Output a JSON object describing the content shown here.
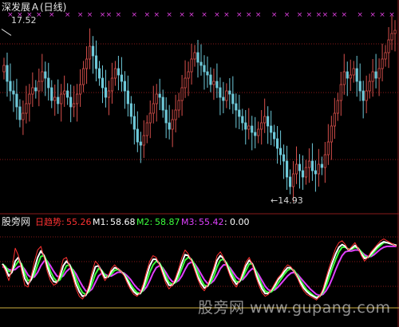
{
  "upper": {
    "title": "深发展Ａ(日线)",
    "high_label": "17.52",
    "low_label": "←14.93",
    "high_value": 17.52,
    "low_value": 14.93,
    "price_range": [
      14.7,
      17.75
    ],
    "marker_glyph": "×"
  },
  "lower": {
    "brand": "股旁网",
    "indicator_label": "日趋势:",
    "indicator_value": "55.26",
    "m1_label": "M1:",
    "m1_value": "58.68",
    "m2_label": "M2:",
    "m2_value": "58.87",
    "m3_label": "M3:",
    "m3_value": "55.42",
    "sep": ":",
    "extra_value": "0.00"
  },
  "watermark": "股旁网 www.gupang.com",
  "colors": {
    "up": "#d8504c",
    "down": "#6ec9d9",
    "grid": "#8a1a1a",
    "marker": "#e040e0",
    "title": "#e8e8e8",
    "indicator": "#ff3232",
    "m1": "#ffffff",
    "m2": "#3cff3c",
    "m3": "#e040ff",
    "extra": "#ffffff",
    "zero_line": "#d0b040"
  },
  "chart_data": [
    {
      "type": "candlestick",
      "title": "深发展Ａ(日线)",
      "annotations": [
        {
          "text": "17.52",
          "value": 17.52
        },
        {
          "text": "←14.93",
          "value": 14.93
        }
      ],
      "closes": [
        16.95,
        16.7,
        16.55,
        16.5,
        16.3,
        16.1,
        16.2,
        16.35,
        16.5,
        16.6,
        16.55,
        16.7,
        16.85,
        16.75,
        16.6,
        16.4,
        16.45,
        16.35,
        16.5,
        16.55,
        16.45,
        16.3,
        16.35,
        16.5,
        16.65,
        16.9,
        17.05,
        17.25,
        17.1,
        16.9,
        16.75,
        16.6,
        16.45,
        16.55,
        16.75,
        16.9,
        16.8,
        16.7,
        16.55,
        16.35,
        16.15,
        15.95,
        15.75,
        15.7,
        15.85,
        16.05,
        16.2,
        16.35,
        16.5,
        16.45,
        16.25,
        16.05,
        15.95,
        16.1,
        16.25,
        16.4,
        16.6,
        16.75,
        16.85,
        17.05,
        17.15,
        17.0,
        16.95,
        16.85,
        16.8,
        16.65,
        16.7,
        16.6,
        16.45,
        16.4,
        16.55,
        16.5,
        16.35,
        16.25,
        16.15,
        16.05,
        15.95,
        16.0,
        15.9,
        15.85,
        15.95,
        16.05,
        16.15,
        16.0,
        15.9,
        15.8,
        15.65,
        15.55,
        15.45,
        15.2,
        15.05,
        15.25,
        15.4,
        15.3,
        15.2,
        15.35,
        15.45,
        15.3,
        15.25,
        15.4,
        15.35,
        15.55,
        15.75,
        16.0,
        16.2,
        16.4,
        16.65,
        16.85,
        16.75,
        16.8,
        16.9,
        16.7,
        16.55,
        16.4,
        16.55,
        16.7,
        16.85,
        16.75,
        16.9,
        17.05,
        17.15,
        17.35,
        17.45,
        17.5
      ],
      "markers_at": [
        2,
        5,
        8,
        11,
        15,
        20,
        24,
        27,
        31,
        33,
        36,
        41,
        45,
        48,
        52,
        56,
        59,
        63,
        67,
        70,
        74,
        77,
        80,
        85,
        89,
        93,
        96,
        99,
        101,
        104,
        107,
        112,
        116,
        119,
        122
      ]
    },
    {
      "type": "line",
      "series": [
        {
          "name": "日趋势",
          "values": [
            62,
            55,
            45,
            58,
            80,
            72,
            55,
            40,
            38,
            50,
            66,
            78,
            82,
            70,
            55,
            45,
            40,
            42,
            55,
            68,
            70,
            60,
            48,
            36,
            28,
            25,
            30,
            40,
            55,
            66,
            62,
            52,
            45,
            50,
            58,
            62,
            58,
            55,
            50,
            42,
            35,
            30,
            28,
            32,
            42,
            55,
            66,
            72,
            70,
            62,
            52,
            42,
            36,
            40,
            48,
            58,
            70,
            78,
            74,
            66,
            56,
            46,
            38,
            34,
            40,
            50,
            60,
            72,
            76,
            70,
            60,
            50,
            42,
            38,
            45,
            55,
            65,
            70,
            62,
            50,
            40,
            32,
            28,
            30,
            36,
            42,
            48,
            52,
            58,
            62,
            60,
            55,
            48,
            40,
            34,
            30,
            28,
            26,
            24,
            28,
            36,
            48,
            60,
            70,
            80,
            86,
            88,
            84,
            78,
            82,
            86,
            80,
            72,
            66,
            70,
            76,
            80,
            84,
            88,
            90,
            88,
            86,
            84,
            82
          ]
        },
        {
          "name": "M1",
          "values": [
            63,
            58,
            50,
            54,
            66,
            70,
            60,
            47,
            41,
            46,
            58,
            70,
            77,
            72,
            60,
            50,
            44,
            43,
            50,
            61,
            66,
            62,
            52,
            41,
            33,
            28,
            29,
            36,
            49,
            60,
            61,
            55,
            48,
            49,
            55,
            59,
            58,
            55,
            51,
            45,
            38,
            33,
            30,
            31,
            38,
            50,
            61,
            68,
            68,
            63,
            55,
            46,
            40,
            40,
            45,
            54,
            64,
            73,
            72,
            67,
            58,
            49,
            42,
            37,
            39,
            47,
            56,
            67,
            72,
            69,
            62,
            53,
            46,
            41,
            44,
            52,
            61,
            67,
            63,
            53,
            44,
            36,
            31,
            31,
            35,
            40,
            46,
            50,
            55,
            59,
            59,
            55,
            49,
            43,
            37,
            33,
            30,
            28,
            26,
            28,
            34,
            44,
            55,
            65,
            74,
            81,
            84,
            82,
            78,
            80,
            83,
            80,
            74,
            69,
            70,
            74,
            78,
            82,
            85,
            87,
            86,
            85,
            84,
            83
          ]
        },
        {
          "name": "M2",
          "values": [
            63,
            60,
            55,
            55,
            61,
            66,
            63,
            53,
            45,
            46,
            52,
            62,
            71,
            72,
            65,
            55,
            48,
            44,
            46,
            54,
            61,
            62,
            56,
            47,
            38,
            32,
            30,
            33,
            42,
            52,
            58,
            56,
            51,
            49,
            52,
            56,
            57,
            55,
            52,
            47,
            41,
            36,
            32,
            31,
            35,
            44,
            54,
            62,
            66,
            64,
            58,
            50,
            43,
            41,
            43,
            49,
            58,
            67,
            70,
            68,
            62,
            54,
            46,
            40,
            39,
            43,
            50,
            60,
            67,
            68,
            64,
            57,
            50,
            44,
            44,
            48,
            56,
            63,
            63,
            56,
            48,
            40,
            34,
            32,
            33,
            37,
            42,
            47,
            52,
            56,
            58,
            56,
            51,
            45,
            40,
            35,
            32,
            29,
            27,
            28,
            32,
            39,
            49,
            59,
            68,
            76,
            81,
            81,
            79,
            79,
            81,
            80,
            76,
            71,
            70,
            72,
            76,
            80,
            83,
            86,
            86,
            85,
            84,
            83
          ]
        },
        {
          "name": "M3",
          "values": [
            60,
            59,
            57,
            56,
            57,
            60,
            61,
            57,
            51,
            48,
            49,
            54,
            61,
            66,
            66,
            61,
            55,
            50,
            48,
            50,
            55,
            58,
            57,
            52,
            45,
            39,
            34,
            33,
            36,
            43,
            50,
            53,
            52,
            50,
            50,
            52,
            54,
            54,
            53,
            50,
            46,
            41,
            37,
            34,
            34,
            38,
            45,
            53,
            59,
            61,
            59,
            54,
            48,
            44,
            43,
            45,
            50,
            57,
            63,
            65,
            63,
            58,
            52,
            46,
            42,
            42,
            45,
            51,
            58,
            62,
            62,
            59,
            54,
            49,
            46,
            46,
            50,
            55,
            58,
            56,
            51,
            45,
            39,
            35,
            34,
            35,
            38,
            42,
            46,
            50,
            53,
            54,
            52,
            48,
            44,
            40,
            36,
            33,
            30,
            29,
            30,
            34,
            40,
            48,
            57,
            65,
            72,
            76,
            77,
            77,
            78,
            78,
            76,
            73,
            71,
            71,
            73,
            76,
            79,
            81,
            82,
            82,
            82,
            82
          ]
        }
      ],
      "ylim": [
        0,
        100
      ]
    }
  ]
}
